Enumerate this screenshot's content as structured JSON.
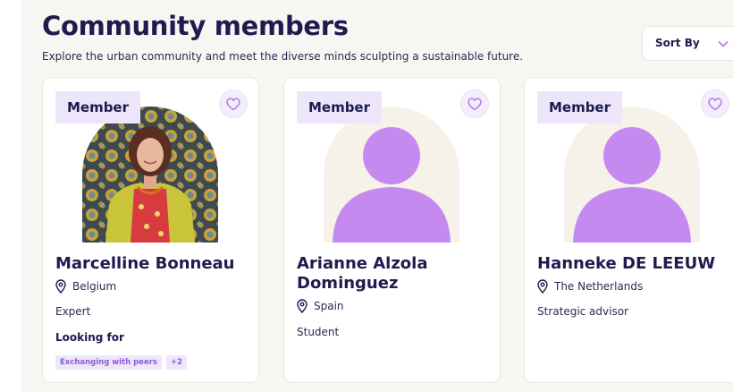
{
  "header": {
    "title": "Community members",
    "subtitle": "Explore the urban community and meet the diverse minds sculpting a sustainable future."
  },
  "sort": {
    "label": "Sort By"
  },
  "colors": {
    "accent": "#b87ef0",
    "badge_bg": "#ede6fb",
    "navy": "#1e1b4f"
  },
  "members": [
    {
      "badge": "Member",
      "name": "Marcelline Bonneau",
      "location": "Belgium",
      "role": "Expert",
      "looking_for_label": "Looking for",
      "tags": [
        "Exchanging with peers",
        "+2"
      ],
      "avatar": "photo"
    },
    {
      "badge": "Member",
      "name": "Arianne Alzola Dominguez",
      "location": "Spain",
      "role": "Student",
      "avatar": "placeholder-person-icon"
    },
    {
      "badge": "Member",
      "name": "Hanneke DE LEEUW",
      "location": "The Netherlands",
      "role": "Strategic advisor",
      "avatar": "placeholder-person-icon"
    }
  ]
}
